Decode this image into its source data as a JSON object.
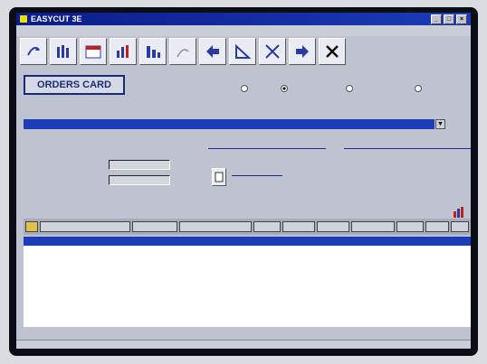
{
  "app": {
    "title": "EASYCUT 3E"
  },
  "menu": [
    "",
    "",
    ""
  ],
  "toolbar": {
    "tools": [
      {
        "name": "refresh-icon"
      },
      {
        "name": "bars-icon"
      },
      {
        "name": "calendar-icon"
      },
      {
        "name": "chart-icon"
      },
      {
        "name": "columns-icon"
      },
      {
        "name": "blank-icon"
      },
      {
        "name": "arrow-left-icon"
      },
      {
        "name": "triangle-icon"
      },
      {
        "name": "scissors-icon"
      },
      {
        "name": "arrow-right-icon"
      },
      {
        "name": "close-icon"
      }
    ]
  },
  "form": {
    "title": "ORDERS CARD",
    "sort_group_label": "",
    "radios": [
      {
        "label": "",
        "selected": false
      },
      {
        "label": "",
        "selected": true
      },
      {
        "label": "",
        "selected": false
      },
      {
        "label": "",
        "selected": false
      }
    ],
    "order_number_label": "",
    "date_label": "",
    "customer_name_label": "",
    "order_value": "",
    "date_value": "",
    "customer_value": "",
    "panel_label_1": "",
    "panel_label_2": "",
    "pieces_label": "",
    "pieces_value": "",
    "cost_label": "",
    "cost_value": "",
    "cover_label": ""
  },
  "grid": {
    "headers": [
      "",
      "",
      "",
      "",
      "",
      "",
      "",
      "",
      ""
    ],
    "entry": [
      "",
      "",
      "",
      "",
      "",
      "",
      "",
      "",
      "",
      ""
    ],
    "rows": [
      [
        "",
        "",
        "",
        "",
        "",
        "",
        "",
        "",
        ""
      ],
      [
        "",
        "",
        "",
        "",
        "",
        "",
        "",
        "",
        ""
      ],
      [
        "",
        "",
        "",
        "",
        "",
        "",
        "",
        "",
        ""
      ],
      [
        "",
        "",
        "",
        "",
        "",
        "",
        "",
        "",
        ""
      ],
      [
        "",
        "",
        "",
        "",
        "",
        "",
        "",
        "",
        ""
      ],
      [
        "",
        "",
        "",
        "",
        "",
        "",
        "",
        "",
        ""
      ],
      [
        "",
        "",
        "",
        "",
        "",
        "",
        "",
        "",
        ""
      ],
      [
        "",
        "",
        "",
        "",
        "",
        "",
        "",
        "",
        ""
      ],
      [
        "",
        "",
        "",
        "",
        "",
        "",
        "",
        "",
        ""
      ]
    ],
    "selected_row": 0
  },
  "status": {
    "right_text": ""
  },
  "colors": {
    "title_bar": "#1b3cb6",
    "selection": "#1c3cb8",
    "label": "#1432a0"
  }
}
